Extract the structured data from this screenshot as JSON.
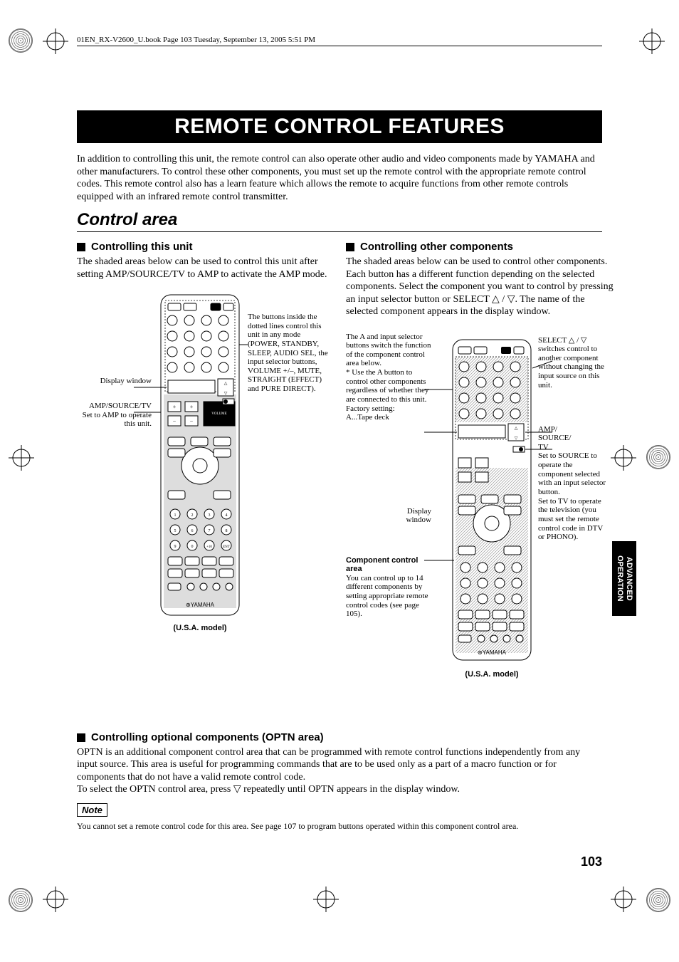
{
  "header_line": "01EN_RX-V2600_U.book  Page 103  Tuesday, September 13, 2005  5:51 PM",
  "title": "REMOTE CONTROL FEATURES",
  "intro": "In addition to controlling this unit, the remote control can also operate other audio and video components made by YAMAHA and other manufacturers. To control these other components, you must set up the remote control with the appropriate remote control codes. This remote control also has a learn feature which allows the remote to acquire functions from other remote controls equipped with an infrared remote control transmitter.",
  "section_title": "Control area",
  "left": {
    "heading": "Controlling this unit",
    "body": "The shaded areas below can be used to control this unit after setting AMP/SOURCE/TV to AMP to activate the AMP mode.",
    "callouts": {
      "display_window": "Display window",
      "amp_source": "AMP/SOURCE/TV\nSet to AMP to operate this unit.",
      "right_text": "The buttons inside the dotted lines control this unit in any mode (POWER, STANDBY, SLEEP, AUDIO SEL, the input selector buttons, VOLUME +/–, MUTE, STRAIGHT (EFFECT) and PURE DIRECT)."
    },
    "caption": "(U.S.A. model)"
  },
  "right": {
    "heading": "Controlling other components",
    "body": "The shaded areas below can be used to control other components. Each button has a different function depending on the selected components. Select the component you want to control by pressing an input selector button or SELECT △ / ▽. The name of the selected component appears in the display window.",
    "callouts": {
      "a_input": "The A and input selector buttons switch the function of the component control area below.\n* Use the A button to control other components regardless of whether they are connected to this unit.\nFactory setting:\nA...Tape deck",
      "select": "SELECT △ / ▽ switches control to another component without changing the input source on this unit.",
      "display_window": "Display window",
      "comp_area_title": "Component control area",
      "comp_area_body": "You can control up to 14 different components by setting appropriate remote control codes (see page 105).",
      "amp_source": "AMP/\nSOURCE/\nTV\nSet to SOURCE to operate the component selected with an input selector button.\nSet to TV to operate the television (you must set the remote control code in DTV or PHONO)."
    },
    "caption": "(U.S.A. model)"
  },
  "optn": {
    "heading": "Controlling optional components (OPTN area)",
    "body": "OPTN is an additional component control area that can be programmed with remote control functions independently from any input source. This area is useful for programming commands that are to be used only as a part of a macro function or for components that do not have a valid remote control code.\nTo select the OPTN control area, press ▽ repeatedly until OPTN appears in the display window.",
    "note_label": "Note",
    "note_text": "You cannot set a remote control code for this area. See page 107 to program buttons operated within this component control area."
  },
  "page_number": "103",
  "side_tab": "ADVANCED\nOPERATION",
  "chart_data": {
    "type": "diagram",
    "description": "Two annotated remote-control diagrams showing shaded control areas for 'Controlling this unit' (AMP mode) and 'Controlling other components' (SOURCE/TV mode). No numeric chart data."
  }
}
